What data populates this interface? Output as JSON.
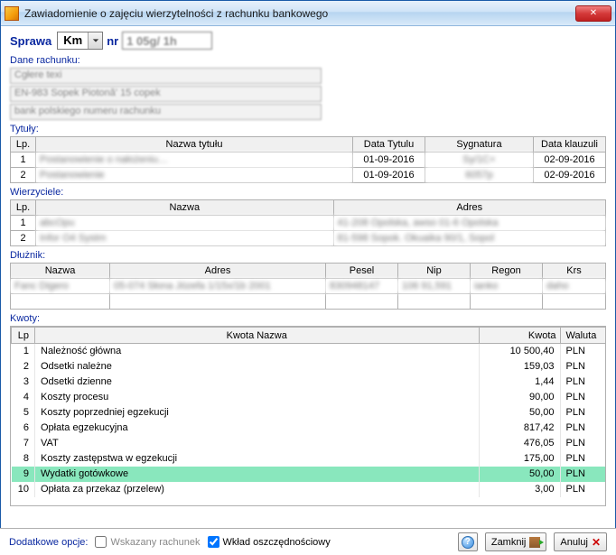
{
  "window": {
    "title": "Zawiadomienie o zajęciu wierzytelności z rachunku bankowego"
  },
  "sprawa": {
    "label": "Sprawa",
    "type_value": "Km",
    "nr_label": "nr",
    "nr_value": "1 05g/ 1h"
  },
  "dane_rachunku": {
    "label": "Dane rachunku:",
    "lines": [
      "Cgłere texi",
      "EN-983 Sopek Piotonă' 15 copek",
      "bank polskiego numeru rachunku"
    ]
  },
  "tytuly": {
    "label": "Tytuły:",
    "headers": {
      "lp": "Lp.",
      "nazwa": "Nazwa tytułu",
      "data_tytulu": "Data Tytulu",
      "sygnatura": "Sygnatura",
      "data_klauzuli": "Data klauzuli"
    },
    "rows": [
      {
        "lp": "1",
        "nazwa": "Postanowienie o nałożeniu…",
        "data_tytulu": "01-09-2016",
        "sygnatura": "Sy/1C+",
        "data_klauzuli": "02-09-2016"
      },
      {
        "lp": "2",
        "nazwa": "Postanowienie",
        "data_tytulu": "01-09-2016",
        "sygnatura": "6057p",
        "data_klauzuli": "02-09-2016"
      }
    ]
  },
  "wierzyciele": {
    "label": "Wierzyciele:",
    "headers": {
      "lp": "Lp.",
      "nazwa": "Nazwa",
      "adres": "Adres"
    },
    "rows": [
      {
        "lp": "1",
        "nazwa": "abcOpu",
        "adres": "41-208 Opolska, awso 01-6 Opolska"
      },
      {
        "lp": "2",
        "nazwa": "Infor O4 Systm",
        "adres": "81-598 Sopok. Okuaika 90/1, Sopol"
      }
    ]
  },
  "dluznik": {
    "label": "Dłużnik:",
    "headers": {
      "nazwa": "Nazwa",
      "adres": "Adres",
      "pesel": "Pesel",
      "nip": "Nip",
      "regon": "Regon",
      "krs": "Krs"
    },
    "row": {
      "nazwa": "Fanc Digero",
      "adres": "05-074 Słona Józefa 1/15x/1b 2001",
      "pesel": "830948147",
      "nip": "106 91,591",
      "regon": "ianko",
      "krs": "daho"
    }
  },
  "kwoty": {
    "label": "Kwoty:",
    "headers": {
      "lp": "Lp",
      "nazwa": "Kwota Nazwa",
      "kwota": "Kwota",
      "waluta": "Waluta"
    },
    "rows": [
      {
        "lp": "1",
        "nazwa": "Należność główna",
        "kwota": "10 500,40",
        "waluta": "PLN"
      },
      {
        "lp": "2",
        "nazwa": "Odsetki należne",
        "kwota": "159,03",
        "waluta": "PLN"
      },
      {
        "lp": "3",
        "nazwa": "Odsetki dzienne",
        "kwota": "1,44",
        "waluta": "PLN"
      },
      {
        "lp": "4",
        "nazwa": "Koszty procesu",
        "kwota": "90,00",
        "waluta": "PLN"
      },
      {
        "lp": "5",
        "nazwa": "Koszty poprzedniej egzekucji",
        "kwota": "50,00",
        "waluta": "PLN"
      },
      {
        "lp": "6",
        "nazwa": "Opłata egzekucyjna",
        "kwota": "817,42",
        "waluta": "PLN"
      },
      {
        "lp": "7",
        "nazwa": "VAT",
        "kwota": "476,05",
        "waluta": "PLN"
      },
      {
        "lp": "8",
        "nazwa": "Koszty zastępstwa w egzekucji",
        "kwota": "175,00",
        "waluta": "PLN"
      },
      {
        "lp": "9",
        "nazwa": "Wydatki gotówkowe",
        "kwota": "50,00",
        "waluta": "PLN",
        "selected": true
      },
      {
        "lp": "10",
        "nazwa": "Opłata za przekaz (przelew)",
        "kwota": "3,00",
        "waluta": "PLN"
      }
    ]
  },
  "footer": {
    "label": "Dodatkowe opcje:",
    "opt_wskazany": "Wskazany rachunek",
    "opt_wklad": "Wkład oszczędnościowy",
    "btn_help": "?",
    "btn_close": "Zamknij",
    "btn_cancel": "Anuluj"
  }
}
